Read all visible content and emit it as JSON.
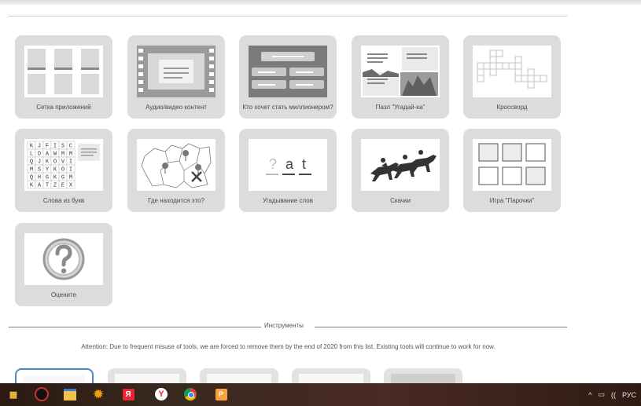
{
  "tiles": [
    {
      "label": "Сетка приложений",
      "thumb": "grid-of-apps"
    },
    {
      "label": "Аудио/видео контент",
      "thumb": "film-strip"
    },
    {
      "label": "Кто хочет стать миллионером?",
      "thumb": "quiz-show"
    },
    {
      "label": "Пазл \"Угадай-ка\"",
      "thumb": "puzzle"
    },
    {
      "label": "Кроссворд",
      "thumb": "crossword"
    },
    {
      "label": "Слова из букв",
      "thumb": "letter-grid"
    },
    {
      "label": "Где находится это?",
      "thumb": "map-pins"
    },
    {
      "label": "Угадывание слов",
      "thumb": "word-guess"
    },
    {
      "label": "Скачки",
      "thumb": "horse-race"
    },
    {
      "label": "Игра \"Парочки\"",
      "thumb": "pairs"
    },
    {
      "label": "Оцените",
      "thumb": "question-mark"
    }
  ],
  "letter_grid": [
    "KJFISC",
    "LDAWMM",
    "QJKOVI",
    "MSYKOI",
    "QHGKGM",
    "KATZEX"
  ],
  "word_guess": {
    "q": "?",
    "a": "a",
    "t": "t"
  },
  "section": {
    "title": "Инструменты"
  },
  "attention": "Attention: Due to frequent misuse of tools, we are forced to remove them by the end of 2020 from this list. Existing tools will continue to work for now.",
  "tools": [
    {
      "selected": true
    },
    {
      "selected": false
    },
    {
      "selected": false
    },
    {
      "selected": false
    },
    {
      "selected": false
    }
  ],
  "taskbar": {
    "icons": [
      "store-icon",
      "camera-app-icon",
      "file-explorer-icon",
      "settings-icon",
      "yandex-icon",
      "yandex-browser-icon",
      "chrome-icon",
      "paint-icon"
    ],
    "language": "РУС"
  }
}
